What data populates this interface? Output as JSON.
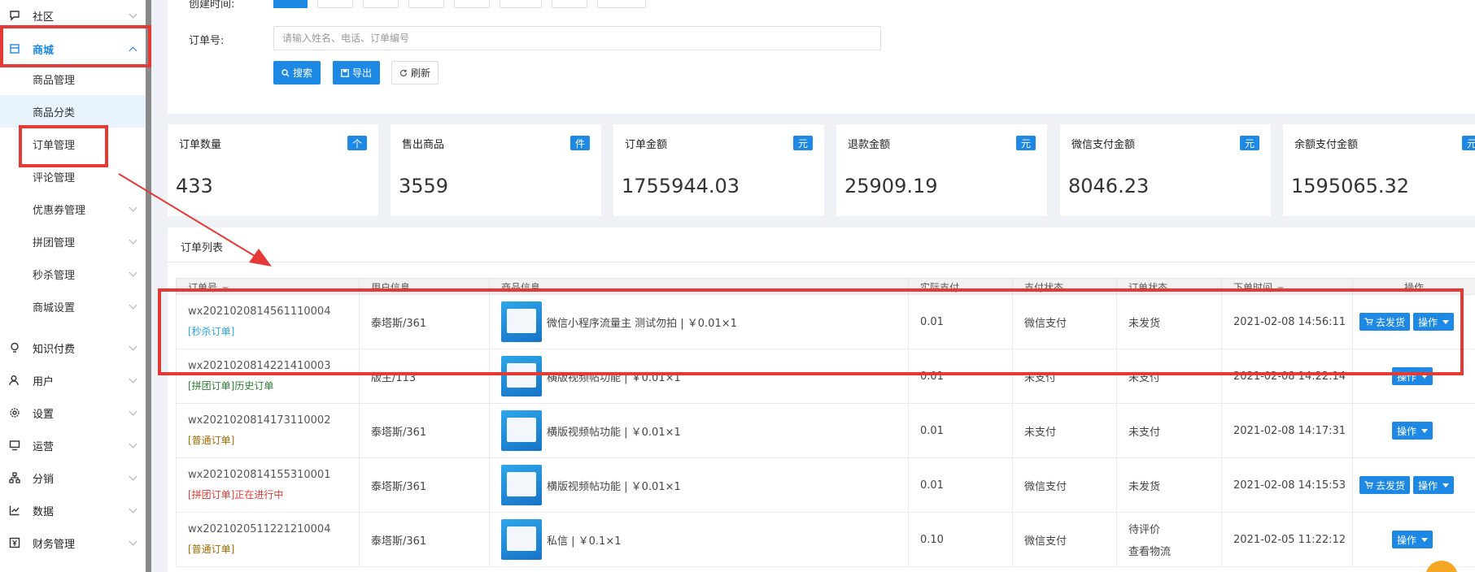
{
  "sidebar": {
    "items": [
      {
        "label": "社区",
        "icon": "chat-icon"
      },
      {
        "label": "商城",
        "icon": "store-icon"
      },
      {
        "label": "知识付费",
        "icon": "bulb-icon"
      },
      {
        "label": "用户",
        "icon": "user-icon"
      },
      {
        "label": "设置",
        "icon": "gear-icon"
      },
      {
        "label": "运营",
        "icon": "monitor-icon"
      },
      {
        "label": "分销",
        "icon": "network-icon"
      },
      {
        "label": "数据",
        "icon": "chart-icon"
      },
      {
        "label": "财务管理",
        "icon": "finance-icon"
      }
    ],
    "mall_sub": [
      "商品管理",
      "商品分类",
      "订单管理",
      "评论管理",
      "优惠券管理",
      "拼团管理",
      "秒杀管理",
      "商城设置"
    ]
  },
  "filter": {
    "created_label": "创建时间:",
    "order_label": "订单号:",
    "order_placeholder": "请输入姓名、电话、订单编号",
    "search_label": "搜索",
    "export_label": "导出",
    "refresh_label": "刷新"
  },
  "stats": [
    {
      "title": "订单数量",
      "unit": "个",
      "value": "433"
    },
    {
      "title": "售出商品",
      "unit": "件",
      "value": "3559"
    },
    {
      "title": "订单金额",
      "unit": "元",
      "value": "1755944.03"
    },
    {
      "title": "退款金额",
      "unit": "元",
      "value": "25909.19"
    },
    {
      "title": "微信支付金额",
      "unit": "元",
      "value": "8046.23"
    },
    {
      "title": "余额支付金额",
      "unit": "元",
      "value": "1595065.32"
    }
  ],
  "order_list": {
    "title": "订单列表",
    "columns": [
      "订单号",
      "用户信息",
      "商品信息",
      "实际支付",
      "支付状态",
      "订单状态",
      "下单时间",
      "操作"
    ],
    "ship_label": "去发货",
    "op_label": "操作",
    "rows": [
      {
        "no": "wx2021020814561110004",
        "tag": "[秒杀订单]",
        "tag_color": "#29a6e0",
        "user": "泰塔斯/361",
        "goods": "微信小程序流量主 测试勿拍 | ￥0.01×1",
        "paid": "0.01",
        "pay_status": "微信支付",
        "order_status": "未发货",
        "time": "2021-02-08 14:56:11",
        "ship": true
      },
      {
        "no": "wx2021020814221410003",
        "tag": "[拼团订单]历史订单",
        "tag_color": "#2e7d32",
        "user": "版主/113",
        "goods": "横版视频帖功能 | ￥0.01×1",
        "paid": "0.01",
        "pay_status": "未支付",
        "order_status": "未支付",
        "time": "2021-02-08 14:22:14",
        "ship": false
      },
      {
        "no": "wx2021020814173110002",
        "tag": "[普通订单]",
        "tag_color": "#a56a00",
        "user": "泰塔斯/361",
        "goods": "横版视频帖功能 | ￥0.01×1",
        "paid": "0.01",
        "pay_status": "未支付",
        "order_status": "未支付",
        "time": "2021-02-08 14:17:31",
        "ship": false
      },
      {
        "no": "wx2021020814155310001",
        "tag": "[拼团订单]正在进行中",
        "tag_color": "#e53935",
        "user": "泰塔斯/361",
        "goods": "横版视频帖功能 | ￥0.01×1",
        "paid": "0.01",
        "pay_status": "微信支付",
        "order_status": "未发货",
        "time": "2021-02-08 14:15:53",
        "ship": true
      },
      {
        "no": "wx2021020511221210004",
        "tag": "[普通订单]",
        "tag_color": "#a56a00",
        "user": "泰塔斯/361",
        "goods": "私信 | ￥0.1×1",
        "paid": "0.10",
        "pay_status": "微信支付",
        "order_status": "待评价",
        "order_status2": "查看物流",
        "time": "2021-02-05 11:22:12",
        "ship": false
      }
    ]
  },
  "colors": {
    "accent": "#1e88e5",
    "annotation": "#e53935"
  }
}
